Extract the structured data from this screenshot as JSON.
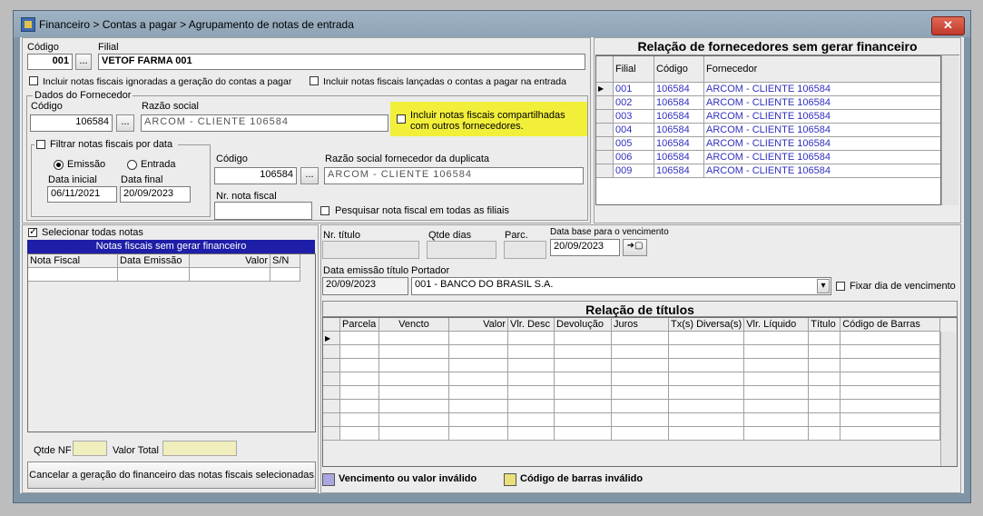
{
  "window": {
    "title": "Financeiro > Contas a pagar > Agrupamento de notas de entrada",
    "close_symbol": "✕"
  },
  "header": {
    "codigo_label": "Código",
    "codigo_value": "001",
    "filial_label": "Filial",
    "filial_value": "VETOF FARMA 001",
    "lookup_btn": "...",
    "chk_ignoradas": "Incluir notas fiscais ignoradas a geração do contas a pagar",
    "chk_lancadas": "Incluir notas fiscais lançadas o contas a pagar na entrada"
  },
  "fornecedor": {
    "group_label": "Dados do Fornecedor",
    "codigo_label": "Código",
    "codigo_value": "106584",
    "razao_label": "Razão social",
    "razao_value": "ARCOM - CLIENTE 106584",
    "compartilhadas": "Incluir notas fiscais compartilhadas com outros fornecedores.",
    "filtrar_label": "Filtrar notas fiscais por data",
    "emissao": "Emissão",
    "entrada": "Entrada",
    "data_inicial_label": "Data inicial",
    "data_inicial": "06/11/2021",
    "data_final_label": "Data final",
    "data_final": "20/09/2023",
    "dup_codigo_label": "Código",
    "dup_codigo_value": "106584",
    "dup_razao_label": "Razão social fornecedor da duplicata",
    "dup_razao_value": "ARCOM - CLIENTE 106584",
    "nr_nota_label": "Nr. nota fiscal",
    "pesquisar_todas": "Pesquisar nota fiscal em todas as filiais"
  },
  "relacao_fornecedores": {
    "title": "Relação de fornecedores sem gerar financeiro",
    "columns": [
      "Filial",
      "Código",
      "Fornecedor"
    ],
    "rows": [
      [
        "001",
        "106584",
        "ARCOM - CLIENTE 106584"
      ],
      [
        "002",
        "106584",
        "ARCOM - CLIENTE 106584"
      ],
      [
        "003",
        "106584",
        "ARCOM - CLIENTE 106584"
      ],
      [
        "004",
        "106584",
        "ARCOM - CLIENTE 106584"
      ],
      [
        "005",
        "106584",
        "ARCOM - CLIENTE 106584"
      ],
      [
        "006",
        "106584",
        "ARCOM - CLIENTE 106584"
      ],
      [
        "009",
        "106584",
        "ARCOM - CLIENTE 106584"
      ]
    ]
  },
  "notas": {
    "selecionar_todas": "Selecionar todas notas",
    "title": "Notas fiscais sem gerar financeiro",
    "columns": [
      "Nota Fiscal",
      "Data Emissão",
      "Valor",
      "S/N"
    ],
    "qtde_nf_label": "Qtde NF",
    "valor_total_label": "Valor Total",
    "cancelar": "Cancelar a geração do financeiro das notas fiscais selecionadas"
  },
  "titulos": {
    "nr_titulo_label": "Nr. título",
    "qtde_dias_label": "Qtde dias",
    "parc_label": "Parc.",
    "data_base_label": "Data base para o vencimento",
    "data_base": "20/09/2023",
    "data_emissao_label": "Data emissão título",
    "data_emissao": "20/09/2023",
    "portador_label": "Portador",
    "portador": "001 - BANCO DO BRASIL S.A.",
    "fixar_dia": "Fixar dia de vencimento",
    "apply_btn": "➜▢",
    "dropdown_arrow": "▾",
    "row_pointer": "▶",
    "title": "Relação de títulos",
    "columns": [
      "Parcela",
      "Vencto",
      "Valor",
      "Vlr. Desc",
      "Devolução",
      "Juros",
      "Tx(s) Diversa(s)",
      "Vlr. Líquido",
      "Título",
      "Código de Barras"
    ]
  },
  "legend": {
    "invalido": "Vencimento ou valor inválido",
    "invalido_color": "#a9a6e0",
    "barras": "Código de barras inválido",
    "barras_color": "#e9e07a"
  },
  "colors": {
    "highlight": "#f2ef3a",
    "grid_header": "#1e1ea8"
  }
}
